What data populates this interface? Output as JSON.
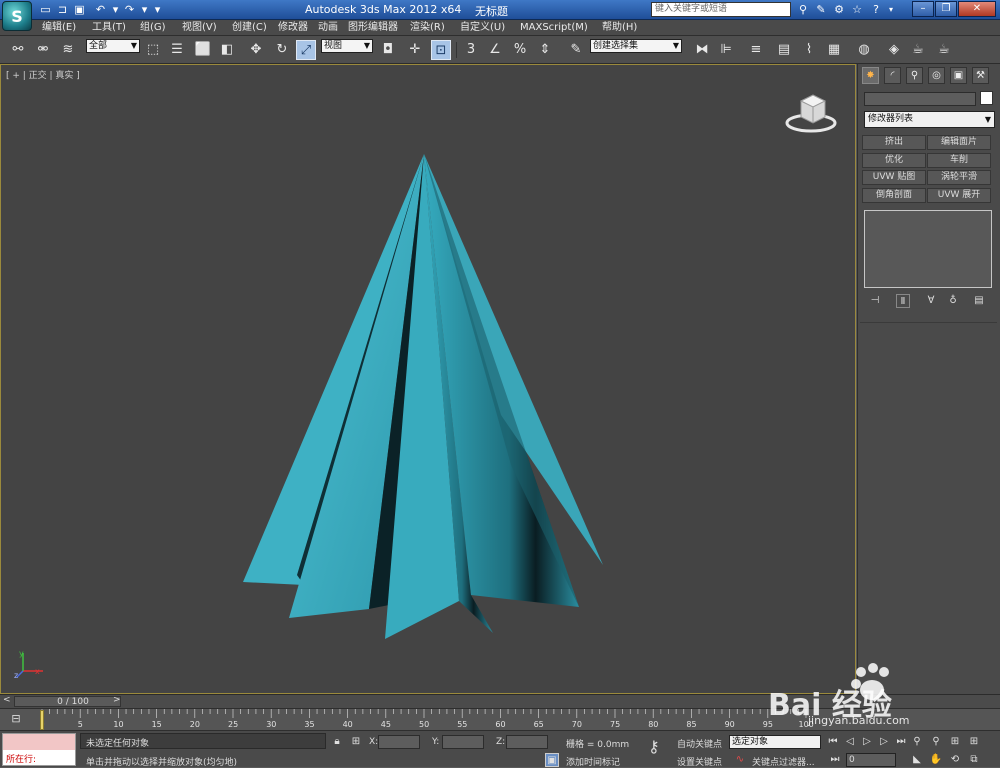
{
  "titlebar": {
    "logo": "3ds-max-logo",
    "app_title": "Autodesk 3ds Max  2012 x64",
    "doc_title": "无标题",
    "search_placeholder": "键入关键字或短语",
    "quick_access": [
      "new-icon",
      "open-icon",
      "save-icon",
      "undo-icon",
      "redo-icon",
      "dropdown-icon"
    ],
    "right_icons": [
      "binoculars-icon",
      "tools-icon",
      "subscription-icon",
      "favorites-icon",
      "help-icon"
    ],
    "window_buttons": [
      "minimize",
      "maximize",
      "close"
    ]
  },
  "menubar": {
    "items": [
      "编辑(E)",
      "工具(T)",
      "组(G)",
      "视图(V)",
      "创建(C)",
      "修改器",
      "动画",
      "图形编辑器",
      "渲染(R)",
      "自定义(U)",
      "MAXScript(M)",
      "帮助(H)"
    ]
  },
  "toolbar": {
    "selection_filter": "全部",
    "reference_coord": "视图",
    "named_selection": "创建选择集"
  },
  "viewport": {
    "label": "[ + | 正交 | 真实 ]",
    "axis": {
      "x": "x",
      "y": "y",
      "z": "z"
    },
    "fill_color": "#3aa8bc",
    "shade_color": "#1a4a54"
  },
  "cmdpanel": {
    "tabs": [
      "create-icon",
      "modify-icon",
      "hierarchy-icon",
      "motion-icon",
      "display-icon",
      "utilities-icon"
    ],
    "modifier_list": "修改器列表",
    "modifier_buttons": [
      "挤出",
      "编辑面片",
      "优化",
      "车削",
      "UVW 贴图",
      "涡轮平滑",
      "倒角剖面",
      "UVW 展开"
    ],
    "stack_icons": [
      "pin-stack-icon",
      "show-end-result-icon",
      "make-unique-icon",
      "remove-modifier-icon",
      "configure-sets-icon"
    ]
  },
  "timeline": {
    "slider_label": "0 / 100",
    "ticks": [
      "0",
      "5",
      "10",
      "15",
      "20",
      "25",
      "30",
      "35",
      "40",
      "45",
      "50",
      "55",
      "60",
      "65",
      "70",
      "75",
      "80",
      "85",
      "90",
      "95",
      "100"
    ]
  },
  "statusbar": {
    "maxscript": "所在行:",
    "selection_status": "未选定任何对象",
    "prompt": "单击并拖动以选择并缩放对象(均匀地)",
    "x_label": "X:",
    "y_label": "Y:",
    "z_label": "Z:",
    "grid": "栅格 = 0.0mm",
    "add_time_tag": "添加时间标记",
    "auto_key": "自动关键点",
    "set_key": "设置关键点",
    "key_mode": "选定对象",
    "key_filters": "关键点过滤器...",
    "current_frame": "0"
  },
  "watermark": {
    "brand": "Bai 经验",
    "url": "jingyan.baidu.com"
  }
}
